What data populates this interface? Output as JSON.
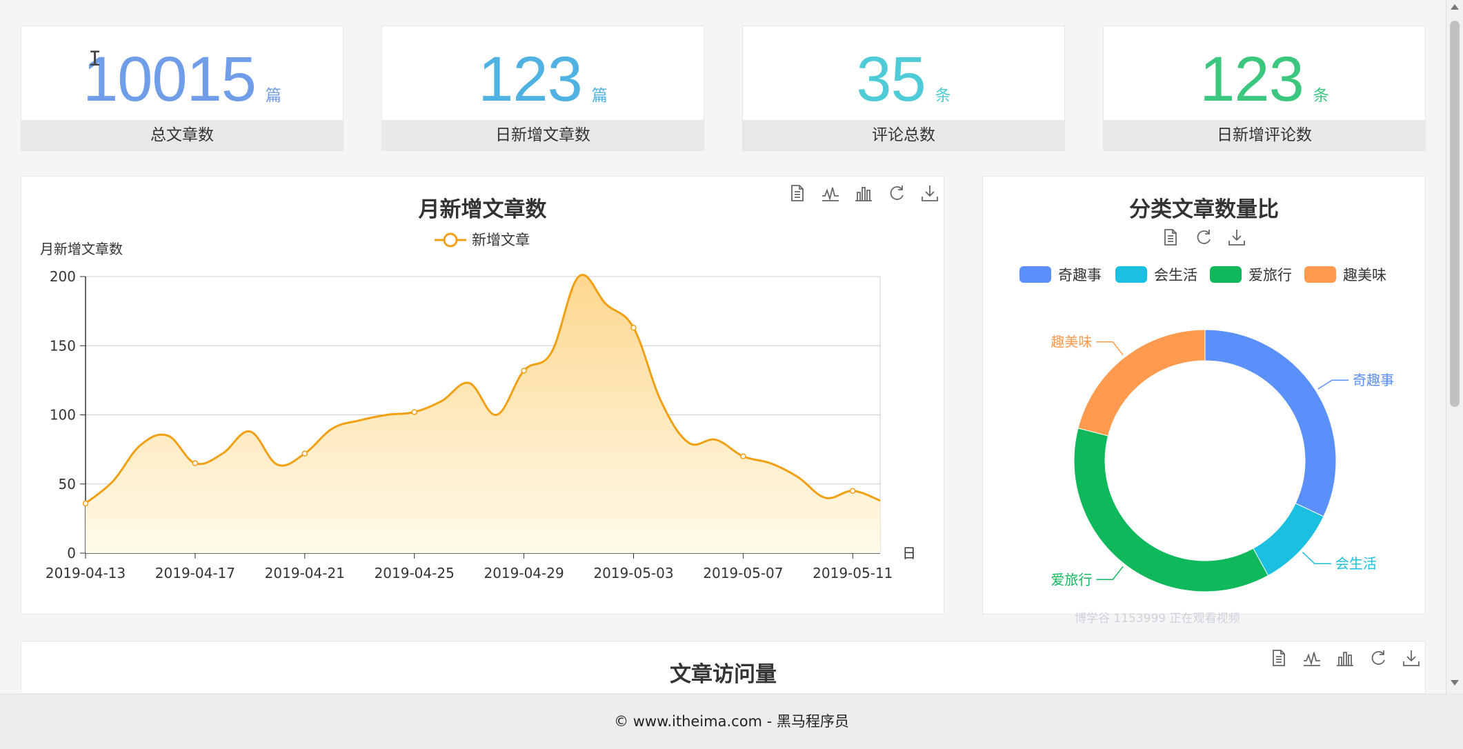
{
  "stats": [
    {
      "value": "10015",
      "unit": "篇",
      "label": "总文章数",
      "color": "#6f9de8"
    },
    {
      "value": "123",
      "unit": "篇",
      "label": "日新增文章数",
      "color": "#4fb2e2"
    },
    {
      "value": "35",
      "unit": "条",
      "label": "评论总数",
      "color": "#4ecbd6"
    },
    {
      "value": "123",
      "unit": "条",
      "label": "日新增评论数",
      "color": "#3cc77f"
    }
  ],
  "line_chart_title": "月新增文章数",
  "pie_chart_title": "分类文章数量比",
  "visits_chart_title": "文章访问量",
  "footer_text": "© www.itheima.com - 黑马程序员",
  "watermark_text": "博学谷 1153999 正在观看视频",
  "icons": {
    "toolbar": [
      "data-view-icon",
      "line-chart-icon",
      "bar-chart-icon",
      "restore-icon",
      "download-icon"
    ],
    "pie_toolbar": [
      "data-view-icon",
      "restore-icon",
      "download-icon"
    ]
  },
  "chart_data": [
    {
      "type": "area",
      "title": "月新增文章数",
      "ylabel": "月新增文章数",
      "xlabel": "日",
      "legend": [
        "新增文章"
      ],
      "legend_position": "top-center",
      "ylim": [
        0,
        200
      ],
      "yticks": [
        0,
        50,
        100,
        150,
        200
      ],
      "grid": true,
      "xtick_labels": [
        "2019-04-13",
        "2019-04-17",
        "2019-04-21",
        "2019-04-25",
        "2019-04-29",
        "2019-05-03",
        "2019-05-07",
        "2019-05-11"
      ],
      "line_color": "#f0a012",
      "x": [
        "2019-04-13",
        "2019-04-14",
        "2019-04-15",
        "2019-04-16",
        "2019-04-17",
        "2019-04-18",
        "2019-04-19",
        "2019-04-20",
        "2019-04-21",
        "2019-04-22",
        "2019-04-23",
        "2019-04-24",
        "2019-04-25",
        "2019-04-26",
        "2019-04-27",
        "2019-04-28",
        "2019-04-29",
        "2019-04-30",
        "2019-05-01",
        "2019-05-02",
        "2019-05-03",
        "2019-05-04",
        "2019-05-05",
        "2019-05-06",
        "2019-05-07",
        "2019-05-08",
        "2019-05-09",
        "2019-05-10",
        "2019-05-11",
        "2019-05-12"
      ],
      "series": [
        {
          "name": "新增文章",
          "values": [
            36,
            52,
            78,
            85,
            65,
            72,
            88,
            64,
            72,
            90,
            96,
            100,
            102,
            110,
            123,
            100,
            132,
            145,
            200,
            180,
            163,
            110,
            80,
            82,
            70,
            65,
            55,
            40,
            45,
            38
          ]
        }
      ]
    },
    {
      "type": "pie",
      "title": "分类文章数量比",
      "legend_position": "top-center",
      "categories": [
        "奇趣事",
        "会生活",
        "爱旅行",
        "趣美味"
      ],
      "values": [
        32,
        10,
        37,
        21
      ],
      "colors": [
        "#5b8ff9",
        "#1bbfe0",
        "#10b85c",
        "#ff9a4f"
      ]
    }
  ]
}
